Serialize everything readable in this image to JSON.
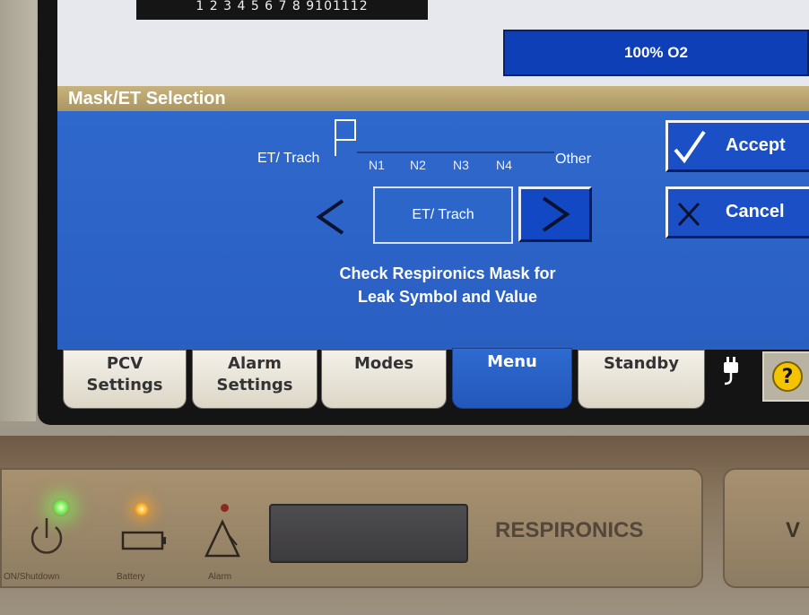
{
  "top_strip": {
    "scale_numbers": "1 2 3 4 5 6 7 8 9101112"
  },
  "oxygen_button": {
    "label": "100% O2"
  },
  "section": {
    "title": "Mask/ET Selection"
  },
  "selector": {
    "left_label": "ET/ Trach",
    "right_label": "Other",
    "positions": [
      "N1",
      "N2",
      "N3",
      "N4"
    ],
    "current_value": "ET/ Trach",
    "prev_symbol": "<",
    "next_symbol": ">"
  },
  "actions": {
    "accept_label": "Accept",
    "cancel_label": "Cancel"
  },
  "info": {
    "line1": "Check Respironics Mask for",
    "line2": "Leak Symbol and Value"
  },
  "tabs": [
    {
      "line1": "PCV",
      "line2": "Settings"
    },
    {
      "line1": "Alarm",
      "line2": "Settings"
    },
    {
      "line1": "Modes",
      "line2": ""
    },
    {
      "line1": "Menu",
      "line2": ""
    },
    {
      "line1": "Standby",
      "line2": ""
    }
  ],
  "active_tab": "Menu",
  "help": {
    "symbol": "?"
  },
  "device": {
    "power_label": "ON/Shutdown",
    "battery_label": "Battery",
    "alarm_label": "Alarm",
    "brand": "RESPIRONICS",
    "brand_partial": "V"
  },
  "colors": {
    "screen_blue": "#2b63c6",
    "section_bar": "#b8a46e",
    "o2_button": "#0e3fb7",
    "active_tab": "#2e6ad0",
    "power_led": "#6ef04a",
    "battery_led": "#ffae20"
  },
  "icons": {
    "accept": "checkmark-icon",
    "cancel": "x-icon",
    "power": "power-icon",
    "battery": "battery-icon",
    "alarm": "alarm-triangle-icon",
    "ac_power": "plug-icon",
    "help": "question-icon",
    "position_marker": "flag-icon"
  }
}
